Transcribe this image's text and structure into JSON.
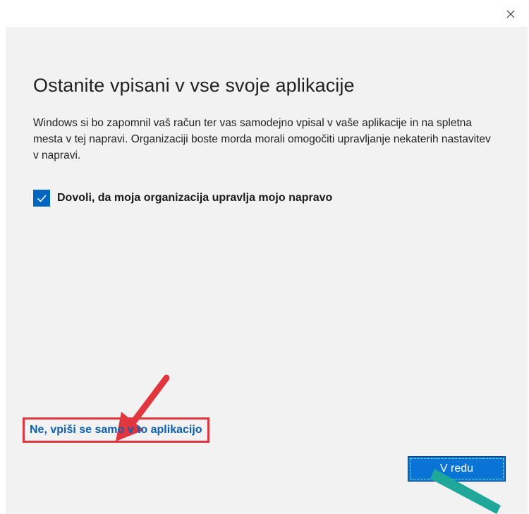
{
  "dialog": {
    "title": "Ostanite vpisani v vse svoje aplikacije",
    "description": "Windows si bo zapomnil vaš račun ter vas samodejno vpisal v vaše aplikacije in na spletna mesta v tej napravi. Organizaciji boste morda morali omogočiti upravljanje nekaterih nastavitev v napravi.",
    "checkbox": {
      "label": "Dovoli, da moja organizacija upravlja mojo napravo",
      "checked": true
    },
    "link_label": "Ne, vpiši se samo v to aplikacijo",
    "ok_label": "V redu"
  },
  "icons": {
    "close": "close-icon",
    "check": "checkmark-icon",
    "red_arrow": "red-arrow-annotation",
    "teal_arrow": "teal-arrow-annotation"
  },
  "colors": {
    "panel_background": "#f2f2f2",
    "accent": "#0067c0",
    "link": "#0a5fb0",
    "ok_button": "#0a74d6",
    "annotation_red": "#e0373f",
    "annotation_teal": "#1fa89a"
  }
}
